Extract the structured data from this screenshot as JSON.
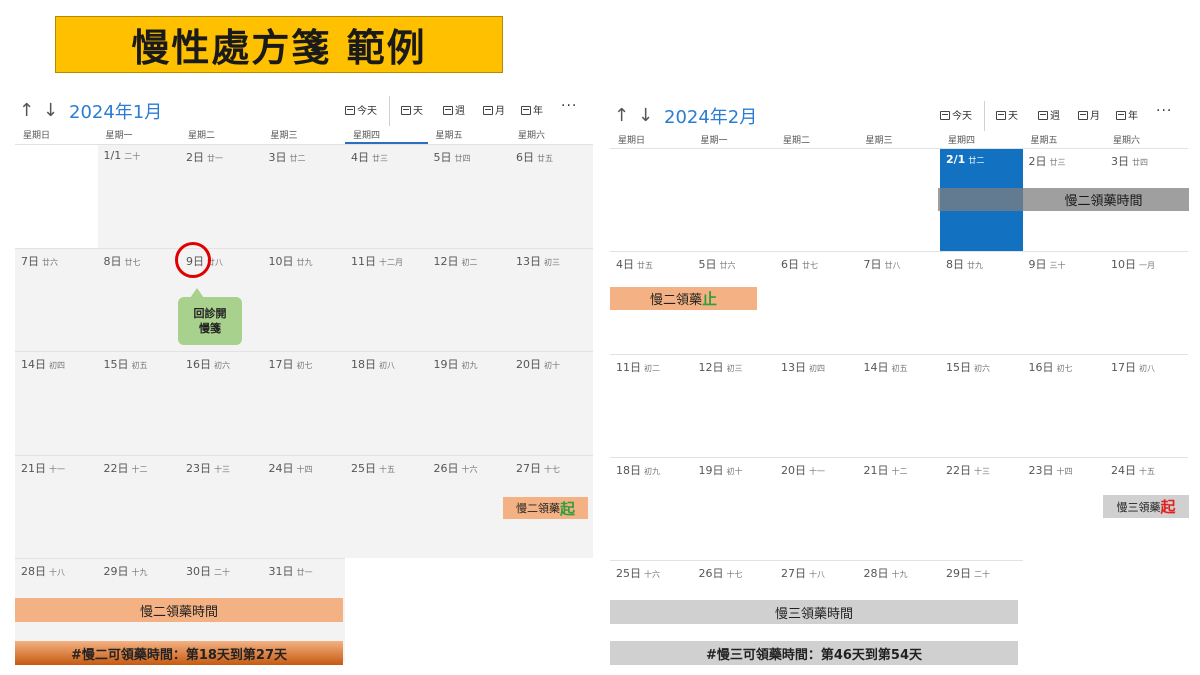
{
  "banner": {
    "title": "慢性處方箋 範例"
  },
  "toolbar": {
    "today": "今天",
    "day": "天",
    "week": "週",
    "month": "月",
    "year": "年",
    "more": "···"
  },
  "weekdays": [
    "星期日",
    "星期一",
    "星期二",
    "星期三",
    "星期四",
    "星期五",
    "星期六"
  ],
  "january": {
    "title": "2024年1月",
    "cells": [
      {
        "n": "",
        "l": ""
      },
      {
        "n": "1/1",
        "l": "二十"
      },
      {
        "n": "2日",
        "l": "廿一"
      },
      {
        "n": "3日",
        "l": "廿二"
      },
      {
        "n": "4日",
        "l": "廿三"
      },
      {
        "n": "5日",
        "l": "廿四"
      },
      {
        "n": "6日",
        "l": "廿五"
      },
      {
        "n": "7日",
        "l": "廿六"
      },
      {
        "n": "8日",
        "l": "廿七"
      },
      {
        "n": "9日",
        "l": "廿八"
      },
      {
        "n": "10日",
        "l": "廿九"
      },
      {
        "n": "11日",
        "l": "十二月"
      },
      {
        "n": "12日",
        "l": "初二"
      },
      {
        "n": "13日",
        "l": "初三"
      },
      {
        "n": "14日",
        "l": "初四"
      },
      {
        "n": "15日",
        "l": "初五"
      },
      {
        "n": "16日",
        "l": "初六"
      },
      {
        "n": "17日",
        "l": "初七"
      },
      {
        "n": "18日",
        "l": "初八"
      },
      {
        "n": "19日",
        "l": "初九"
      },
      {
        "n": "20日",
        "l": "初十"
      },
      {
        "n": "21日",
        "l": "十一"
      },
      {
        "n": "22日",
        "l": "十二"
      },
      {
        "n": "23日",
        "l": "十三"
      },
      {
        "n": "24日",
        "l": "十四"
      },
      {
        "n": "25日",
        "l": "十五"
      },
      {
        "n": "26日",
        "l": "十六"
      },
      {
        "n": "27日",
        "l": "十七"
      },
      {
        "n": "28日",
        "l": "十八"
      },
      {
        "n": "29日",
        "l": "十九"
      },
      {
        "n": "30日",
        "l": "二十"
      },
      {
        "n": "31日",
        "l": "廿一"
      }
    ],
    "callout": "回診開\n慢箋",
    "start_label_prefix": "慢二領藥",
    "start_label_strong": "起",
    "period_bar": "慢二領藥時間",
    "summary": "#慢二可領藥時間：第18天到第27天"
  },
  "february": {
    "title": "2024年2月",
    "cells": [
      {
        "n": "",
        "l": ""
      },
      {
        "n": "",
        "l": ""
      },
      {
        "n": "",
        "l": ""
      },
      {
        "n": "",
        "l": ""
      },
      {
        "n": "2/1",
        "l": "廿二"
      },
      {
        "n": "2日",
        "l": "廿三"
      },
      {
        "n": "3日",
        "l": "廿四"
      },
      {
        "n": "4日",
        "l": "廿五"
      },
      {
        "n": "5日",
        "l": "廿六"
      },
      {
        "n": "6日",
        "l": "廿七"
      },
      {
        "n": "7日",
        "l": "廿八"
      },
      {
        "n": "8日",
        "l": "廿九"
      },
      {
        "n": "9日",
        "l": "三十"
      },
      {
        "n": "10日",
        "l": "一月"
      },
      {
        "n": "11日",
        "l": "初二"
      },
      {
        "n": "12日",
        "l": "初三"
      },
      {
        "n": "13日",
        "l": "初四"
      },
      {
        "n": "14日",
        "l": "初五"
      },
      {
        "n": "15日",
        "l": "初六"
      },
      {
        "n": "16日",
        "l": "初七"
      },
      {
        "n": "17日",
        "l": "初八"
      },
      {
        "n": "18日",
        "l": "初九"
      },
      {
        "n": "19日",
        "l": "初十"
      },
      {
        "n": "20日",
        "l": "十一"
      },
      {
        "n": "21日",
        "l": "十二"
      },
      {
        "n": "22日",
        "l": "十三"
      },
      {
        "n": "23日",
        "l": "十四"
      },
      {
        "n": "24日",
        "l": "十五"
      },
      {
        "n": "25日",
        "l": "十六"
      },
      {
        "n": "26日",
        "l": "十七"
      },
      {
        "n": "27日",
        "l": "十八"
      },
      {
        "n": "28日",
        "l": "十九"
      },
      {
        "n": "29日",
        "l": "二十"
      }
    ],
    "week_bar": "慢二領藥時間",
    "end_label_prefix": "慢二領藥",
    "end_label_strong": "止",
    "start_label_prefix": "慢三領藥",
    "start_label_strong": "起",
    "period_bar": "慢三領藥時間",
    "summary": "#慢三可領藥時間：第46天到第54天"
  },
  "colors": {
    "banner": "#ffc000",
    "today": "#1371c1",
    "accent_blue": "#2b7cd3",
    "salmon": "#f4b183",
    "week_bar_gray": "#7f7f7f",
    "light_gray": "#d0d0d0",
    "orange_gradient_start": "#f4b183",
    "orange_gradient_end": "#c55a11",
    "callout_green": "#a9d18e",
    "circle_red": "#e00000"
  }
}
